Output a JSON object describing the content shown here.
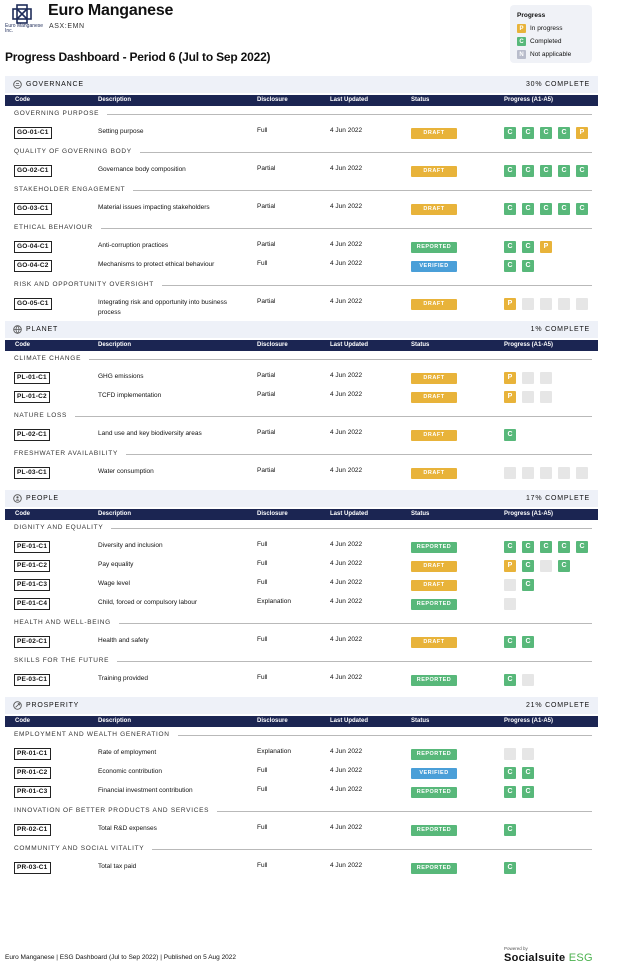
{
  "header": {
    "logo_text": "Euro Manganese Inc.",
    "company": "Euro Manganese",
    "ticker": "ASX:EMN"
  },
  "legend": {
    "title": "Progress",
    "items": [
      {
        "code": "P",
        "label": "In progress",
        "color": "#e8b33a"
      },
      {
        "code": "C",
        "label": "Completed",
        "color": "#58b87a"
      },
      {
        "code": "N",
        "label": "Not applicable",
        "color": "#b8bccb"
      }
    ]
  },
  "page_title": "Progress Dashboard - Period 6 (Jul to Sep 2022)",
  "columns": [
    "Code",
    "Description",
    "Disclosure",
    "Last Updated",
    "Status",
    "Progress (A1-A5)"
  ],
  "colors": {
    "navy": "#1b2552",
    "draft": "#e8b33a",
    "reported": "#58b87a",
    "verified": "#4a9fd8",
    "completed": "#58b87a",
    "in_progress": "#e8b33a",
    "empty": "#e6e6e6",
    "band": "#eef1f8"
  },
  "sections": [
    {
      "name": "GOVERNANCE",
      "icon": "governance-icon",
      "complete": "30% COMPLETE",
      "categories": [
        {
          "name": "GOVERNING PURPOSE",
          "rows": [
            {
              "code": "GO-01-C1",
              "desc": "Setting purpose",
              "disc": "Full",
              "updated": "4 Jun 2022",
              "status": "DRAFT",
              "progress": [
                "C",
                "C",
                "C",
                "C",
                "P"
              ]
            }
          ]
        },
        {
          "name": "QUALITY OF GOVERNING BODY",
          "rows": [
            {
              "code": "GO-02-C1",
              "desc": "Governance body composition",
              "disc": "Partial",
              "updated": "4 Jun 2022",
              "status": "DRAFT",
              "progress": [
                "C",
                "C",
                "C",
                "C",
                "C"
              ]
            }
          ]
        },
        {
          "name": "STAKEHOLDER ENGAGEMENT",
          "rows": [
            {
              "code": "GO-03-C1",
              "desc": "Material issues impacting stakeholders",
              "disc": "Partial",
              "updated": "4 Jun 2022",
              "status": "DRAFT",
              "progress": [
                "C",
                "C",
                "C",
                "C",
                "C"
              ]
            }
          ]
        },
        {
          "name": "ETHICAL BEHAVIOUR",
          "rows": [
            {
              "code": "GO-04-C1",
              "desc": "Anti-corruption practices",
              "disc": "Partial",
              "updated": "4 Jun 2022",
              "status": "REPORTED",
              "progress": [
                "C",
                "C",
                "P"
              ]
            },
            {
              "code": "GO-04-C2",
              "desc": "Mechanisms to protect ethical behaviour",
              "disc": "Full",
              "updated": "4 Jun 2022",
              "status": "VERIFIED",
              "progress": [
                "C",
                "C"
              ]
            }
          ]
        },
        {
          "name": "RISK AND OPPORTUNITY OVERSIGHT",
          "rows": [
            {
              "code": "GO-05-C1",
              "desc": "Integrating risk and opportunity into business process",
              "disc": "Partial",
              "updated": "4 Jun 2022",
              "status": "DRAFT",
              "progress": [
                "P",
                "",
                "",
                "",
                ""
              ]
            }
          ]
        }
      ]
    },
    {
      "name": "PLANET",
      "icon": "globe-icon",
      "complete": "1% COMPLETE",
      "categories": [
        {
          "name": "CLIMATE CHANGE",
          "rows": [
            {
              "code": "PL-01-C1",
              "desc": "GHG emissions",
              "disc": "Partial",
              "updated": "4 Jun 2022",
              "status": "DRAFT",
              "progress": [
                "P",
                "",
                ""
              ]
            },
            {
              "code": "PL-01-C2",
              "desc": "TCFD implementation",
              "disc": "Partial",
              "updated": "4 Jun 2022",
              "status": "DRAFT",
              "progress": [
                "P",
                "",
                ""
              ]
            }
          ]
        },
        {
          "name": "NATURE LOSS",
          "rows": [
            {
              "code": "PL-02-C1",
              "desc": "Land use and key biodiversity areas",
              "disc": "Partial",
              "updated": "4 Jun 2022",
              "status": "DRAFT",
              "progress": [
                "C"
              ]
            }
          ]
        },
        {
          "name": "FRESHWATER AVAILABILITY",
          "rows": [
            {
              "code": "PL-03-C1",
              "desc": "Water consumption",
              "disc": "Partial",
              "updated": "4 Jun 2022",
              "status": "DRAFT",
              "progress": [
                "",
                "",
                "",
                "",
                ""
              ]
            }
          ]
        }
      ]
    },
    {
      "name": "PEOPLE",
      "icon": "people-icon",
      "complete": "17% COMPLETE",
      "categories": [
        {
          "name": "DIGNITY AND EQUALITY",
          "rows": [
            {
              "code": "PE-01-C1",
              "desc": "Diversity and inclusion",
              "disc": "Full",
              "updated": "4 Jun 2022",
              "status": "REPORTED",
              "progress": [
                "C",
                "C",
                "C",
                "C",
                "C"
              ]
            },
            {
              "code": "PE-01-C2",
              "desc": "Pay equality",
              "disc": "Full",
              "updated": "4 Jun 2022",
              "status": "DRAFT",
              "progress": [
                "P",
                "C",
                "",
                "C"
              ]
            },
            {
              "code": "PE-01-C3",
              "desc": "Wage level",
              "disc": "Full",
              "updated": "4 Jun 2022",
              "status": "DRAFT",
              "progress": [
                "",
                "C"
              ]
            },
            {
              "code": "PE-01-C4",
              "desc": "Child, forced or compulsory labour",
              "disc": "Explanation",
              "updated": "4 Jun 2022",
              "status": "REPORTED",
              "progress": [
                ""
              ]
            }
          ]
        },
        {
          "name": "HEALTH AND WELL-BEING",
          "rows": [
            {
              "code": "PE-02-C1",
              "desc": "Health and safety",
              "disc": "Full",
              "updated": "4 Jun 2022",
              "status": "DRAFT",
              "progress": [
                "C",
                "C"
              ]
            }
          ]
        },
        {
          "name": "SKILLS FOR THE FUTURE",
          "rows": [
            {
              "code": "PE-03-C1",
              "desc": "Training provided",
              "disc": "Full",
              "updated": "4 Jun 2022",
              "status": "REPORTED",
              "progress": [
                "C",
                ""
              ]
            }
          ]
        }
      ]
    },
    {
      "name": "PROSPERITY",
      "icon": "prosperity-icon",
      "complete": "21% COMPLETE",
      "categories": [
        {
          "name": "EMPLOYMENT AND WEALTH GENERATION",
          "rows": [
            {
              "code": "PR-01-C1",
              "desc": "Rate of employment",
              "disc": "Explanation",
              "updated": "4 Jun 2022",
              "status": "REPORTED",
              "progress": [
                "",
                ""
              ]
            },
            {
              "code": "PR-01-C2",
              "desc": "Economic contribution",
              "disc": "Full",
              "updated": "4 Jun 2022",
              "status": "VERIFIED",
              "progress": [
                "C",
                "C"
              ]
            },
            {
              "code": "PR-01-C3",
              "desc": "Financial investment contribution",
              "disc": "Full",
              "updated": "4 Jun 2022",
              "status": "REPORTED",
              "progress": [
                "C",
                "C"
              ]
            }
          ]
        },
        {
          "name": "INNOVATION OF BETTER PRODUCTS AND SERVICES",
          "rows": [
            {
              "code": "PR-02-C1",
              "desc": "Total R&D expenses",
              "disc": "Full",
              "updated": "4 Jun 2022",
              "status": "REPORTED",
              "progress": [
                "C"
              ]
            }
          ]
        },
        {
          "name": "COMMUNITY AND SOCIAL VITALITY",
          "rows": [
            {
              "code": "PR-03-C1",
              "desc": "Total tax paid",
              "disc": "Full",
              "updated": "4 Jun 2022",
              "status": "REPORTED",
              "progress": [
                "C"
              ]
            }
          ]
        }
      ]
    }
  ],
  "footer": {
    "text": "Euro Manganese | ESG Dashboard (Jul to Sep 2022) | Published on 5 Aug 2022",
    "powered": "Powered by",
    "brand_main": "Socialsuite",
    "brand_accent": "ESG"
  }
}
